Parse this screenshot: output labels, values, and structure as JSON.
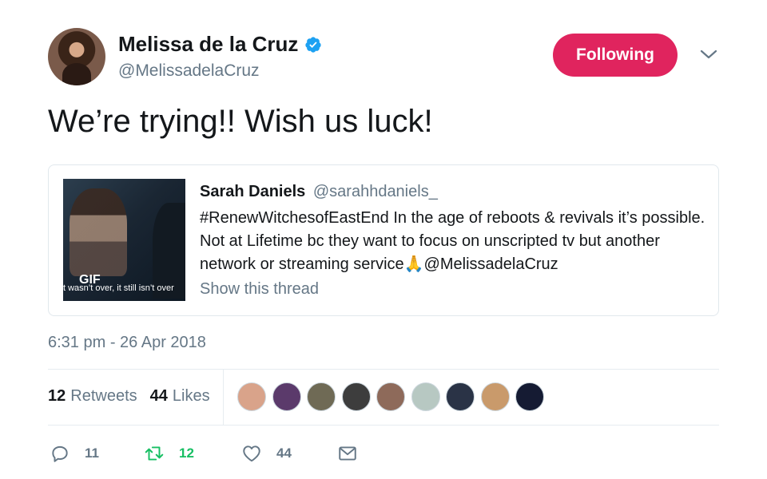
{
  "author": {
    "display_name": "Melissa de la Cruz",
    "handle": "@MelissadelaCruz",
    "verified": true
  },
  "follow_button": {
    "label": "Following",
    "color": "#e0245e"
  },
  "tweet": {
    "text": "We’re trying!! Wish us luck!"
  },
  "quote": {
    "author_name": "Sarah Daniels",
    "author_handle": "@sarahhdaniels_",
    "text": "#RenewWitchesofEastEnd In the age of reboots & revivals it’s possible. Not at Lifetime bc they want to focus on unscripted tv but another network or streaming service🙏@MelissadelaCruz",
    "media": {
      "badge": "GIF",
      "caption": "t wasn’t over, it still isn’t over"
    },
    "show_thread": "Show this thread"
  },
  "timestamp": "6:31 pm - 26 Apr 2018",
  "stats": {
    "retweets_count": "12",
    "retweets_label": "Retweets",
    "likes_count": "44",
    "likes_label": "Likes"
  },
  "likers": [
    {
      "name": "liker-avatar-1",
      "color": "#d9a38a"
    },
    {
      "name": "liker-avatar-2",
      "color": "#5b3a6b"
    },
    {
      "name": "liker-avatar-3",
      "color": "#6f6a55"
    },
    {
      "name": "liker-avatar-4",
      "color": "#3d3d3d"
    },
    {
      "name": "liker-avatar-5",
      "color": "#8e6a5a"
    },
    {
      "name": "liker-avatar-6",
      "color": "#b7c8c2"
    },
    {
      "name": "liker-avatar-7",
      "color": "#2a3346"
    },
    {
      "name": "liker-avatar-8",
      "color": "#c99a6b"
    },
    {
      "name": "liker-avatar-9",
      "color": "#151b33"
    }
  ],
  "actions": {
    "reply_count": "11",
    "retweet_count": "12",
    "like_count": "44"
  },
  "colors": {
    "accent": "#1da1f2",
    "retweet_green": "#17bf63",
    "muted_text": "#657786"
  },
  "icons": [
    "verified-badge-icon",
    "chevron-down-icon",
    "reply-icon",
    "retweet-icon",
    "heart-icon",
    "envelope-icon"
  ]
}
